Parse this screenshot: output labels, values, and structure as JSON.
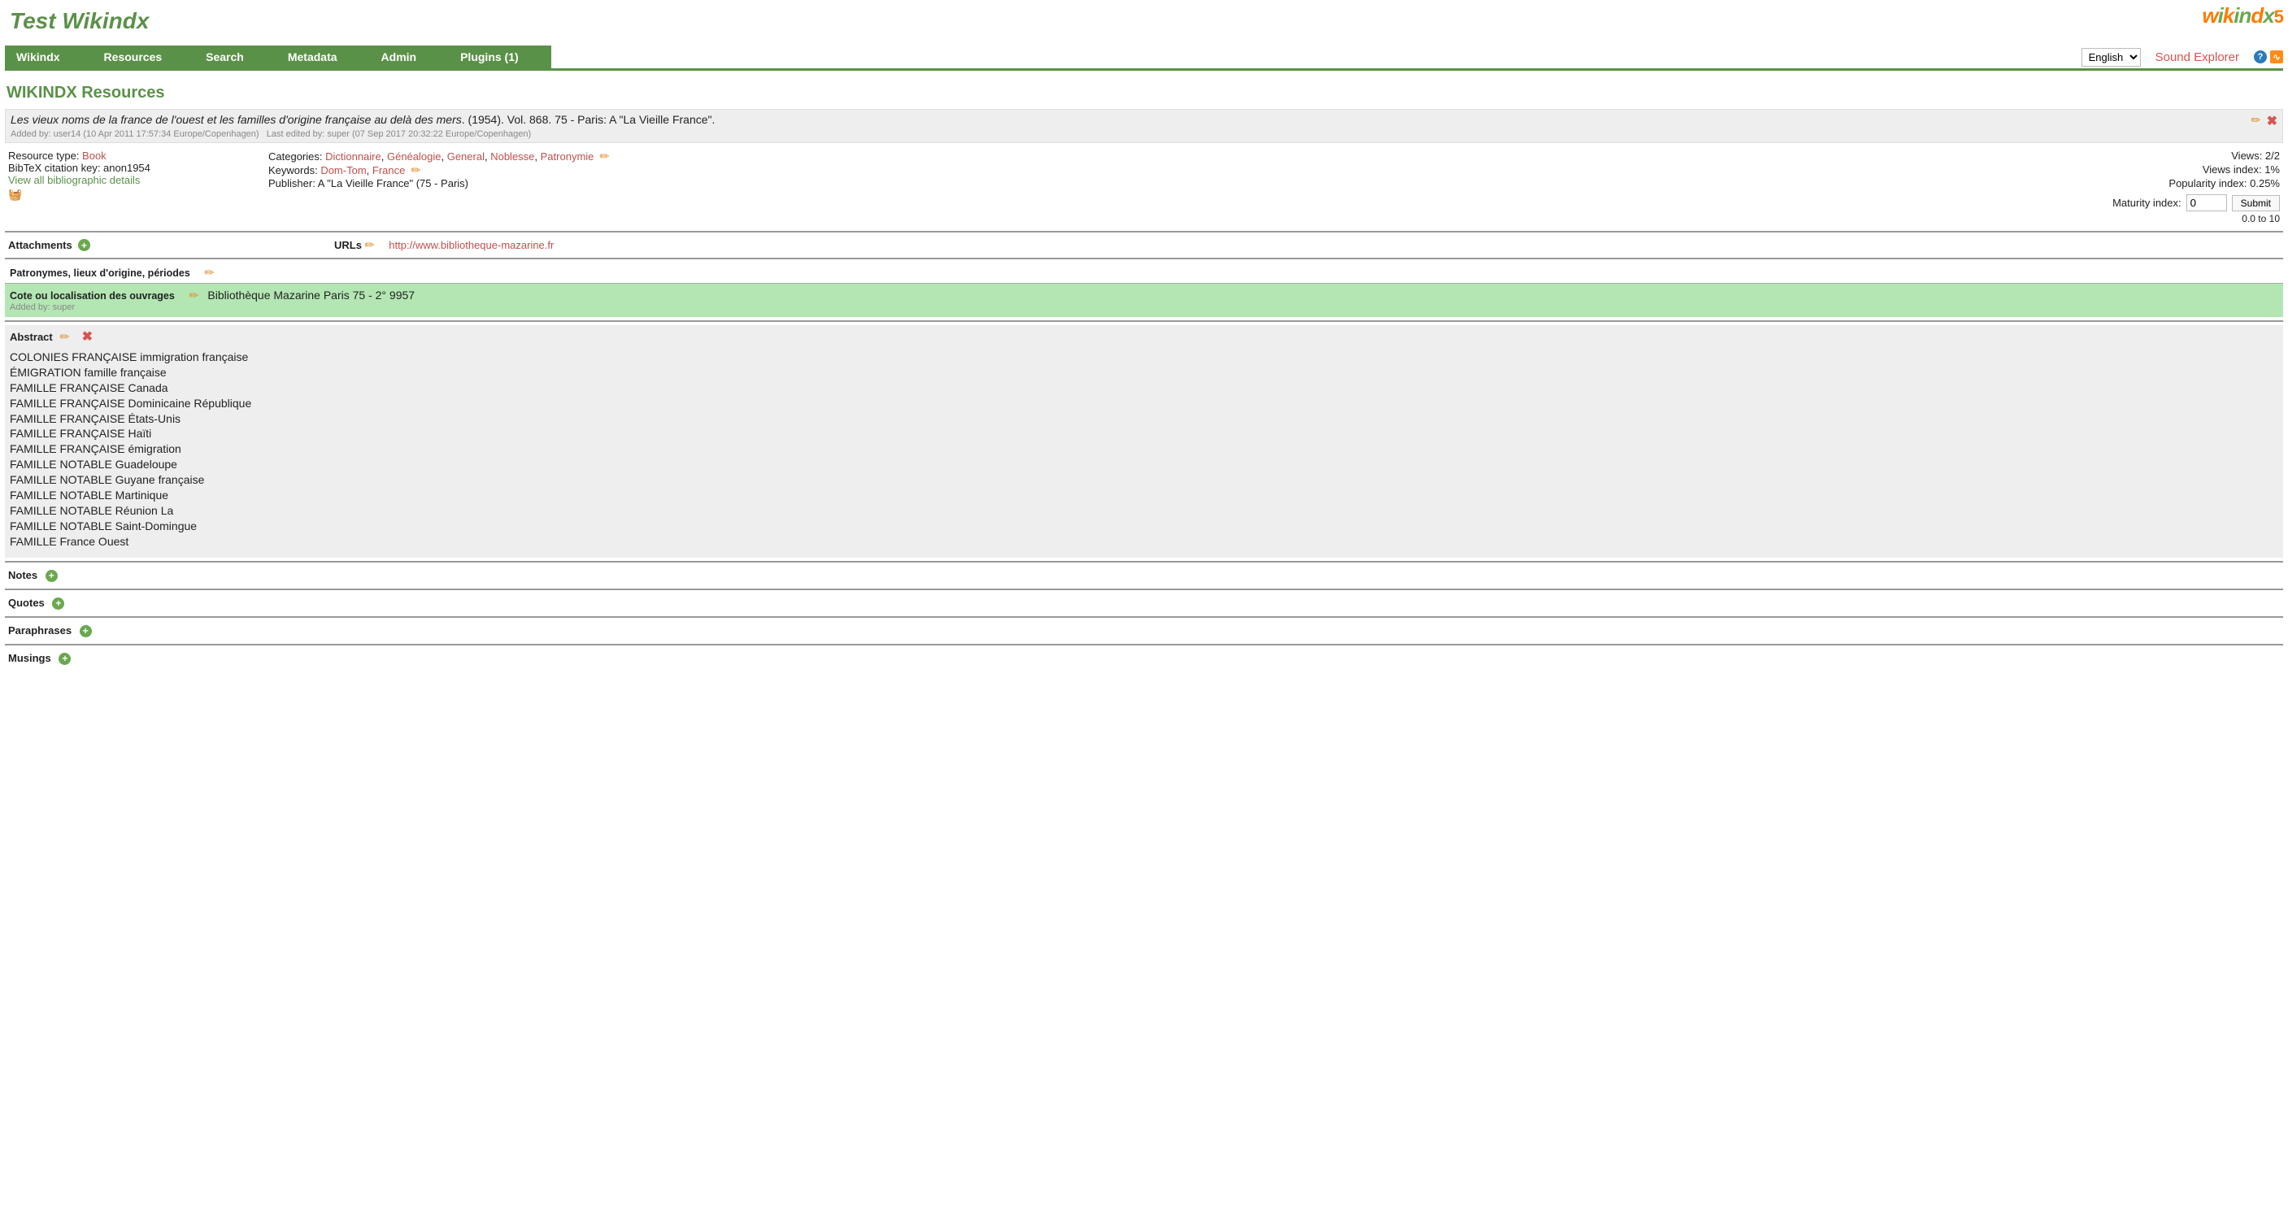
{
  "header": {
    "site_title": "Test Wikindx",
    "logo_text": "wikindx",
    "logo_version": "5"
  },
  "nav": {
    "menu": [
      "Wikindx",
      "Resources",
      "Search",
      "Metadata",
      "Admin",
      "Plugins (1)"
    ],
    "language": "English",
    "sound_explorer": "Sound Explorer"
  },
  "page": {
    "title": "WIKINDX Resources"
  },
  "citation": {
    "title": "Les vieux noms de la france de l'ouest et les familles d'origine française au delà des mers",
    "rest": ". (1954). Vol. 868. 75 - Paris: A \"La Vieille France\".",
    "added_by": "Added by: user14 (10 Apr 2011 17:57:34 Europe/Copenhagen)",
    "last_edited": "Last edited by: super (07 Sep 2017 20:32:22 Europe/Copenhagen)"
  },
  "details": {
    "left": {
      "resource_type_label": "Resource type: ",
      "resource_type": "Book",
      "bibtex_label": "BibTeX citation key: anon1954",
      "view_all": "View all bibliographic details"
    },
    "mid": {
      "categories_label": "Categories: ",
      "categories": [
        "Dictionnaire",
        "Généalogie",
        "General",
        "Noblesse",
        "Patronymie"
      ],
      "keywords_label": "Keywords: ",
      "keywords": [
        "Dom-Tom",
        "France"
      ],
      "publisher_label": "Publisher: ",
      "publisher": "A \"La Vieille France\" (75 - Paris)"
    },
    "right": {
      "views": "Views: 2/2",
      "views_index": "Views index: 1%",
      "popularity_index": "Popularity index: 0.25%",
      "maturity_label": "Maturity index:",
      "maturity_value": "0",
      "submit": "Submit",
      "range": "0.0 to 10"
    }
  },
  "attachments": {
    "label": "Attachments",
    "urls_label": "URLs",
    "url": "http://www.bibliotheque-mazarine.fr"
  },
  "custom_fields": {
    "patronymes": {
      "label": "Patronymes, lieux d'origine, périodes"
    },
    "cote": {
      "label": "Cote ou localisation des ouvrages",
      "value": "Bibliothèque Mazarine Paris 75 - 2° 9957",
      "added_by": "Added by: super"
    }
  },
  "abstract": {
    "label": "Abstract",
    "lines": [
      "COLONIES FRANÇAISE immigration française",
      "ÉMIGRATION famille française",
      "FAMILLE FRANÇAISE Canada",
      "FAMILLE FRANÇAISE Dominicaine République",
      "FAMILLE FRANÇAISE États-Unis",
      "FAMILLE FRANÇAISE Haïti",
      "FAMILLE FRANÇAISE émigration",
      "FAMILLE NOTABLE Guadeloupe",
      "FAMILLE NOTABLE Guyane française",
      "FAMILLE NOTABLE Martinique",
      "FAMILLE NOTABLE Réunion La",
      "FAMILLE NOTABLE Saint-Domingue",
      "FAMILLE France Ouest"
    ]
  },
  "bottom": {
    "notes": "Notes",
    "quotes": "Quotes",
    "paraphrases": "Paraphrases",
    "musings": "Musings"
  }
}
